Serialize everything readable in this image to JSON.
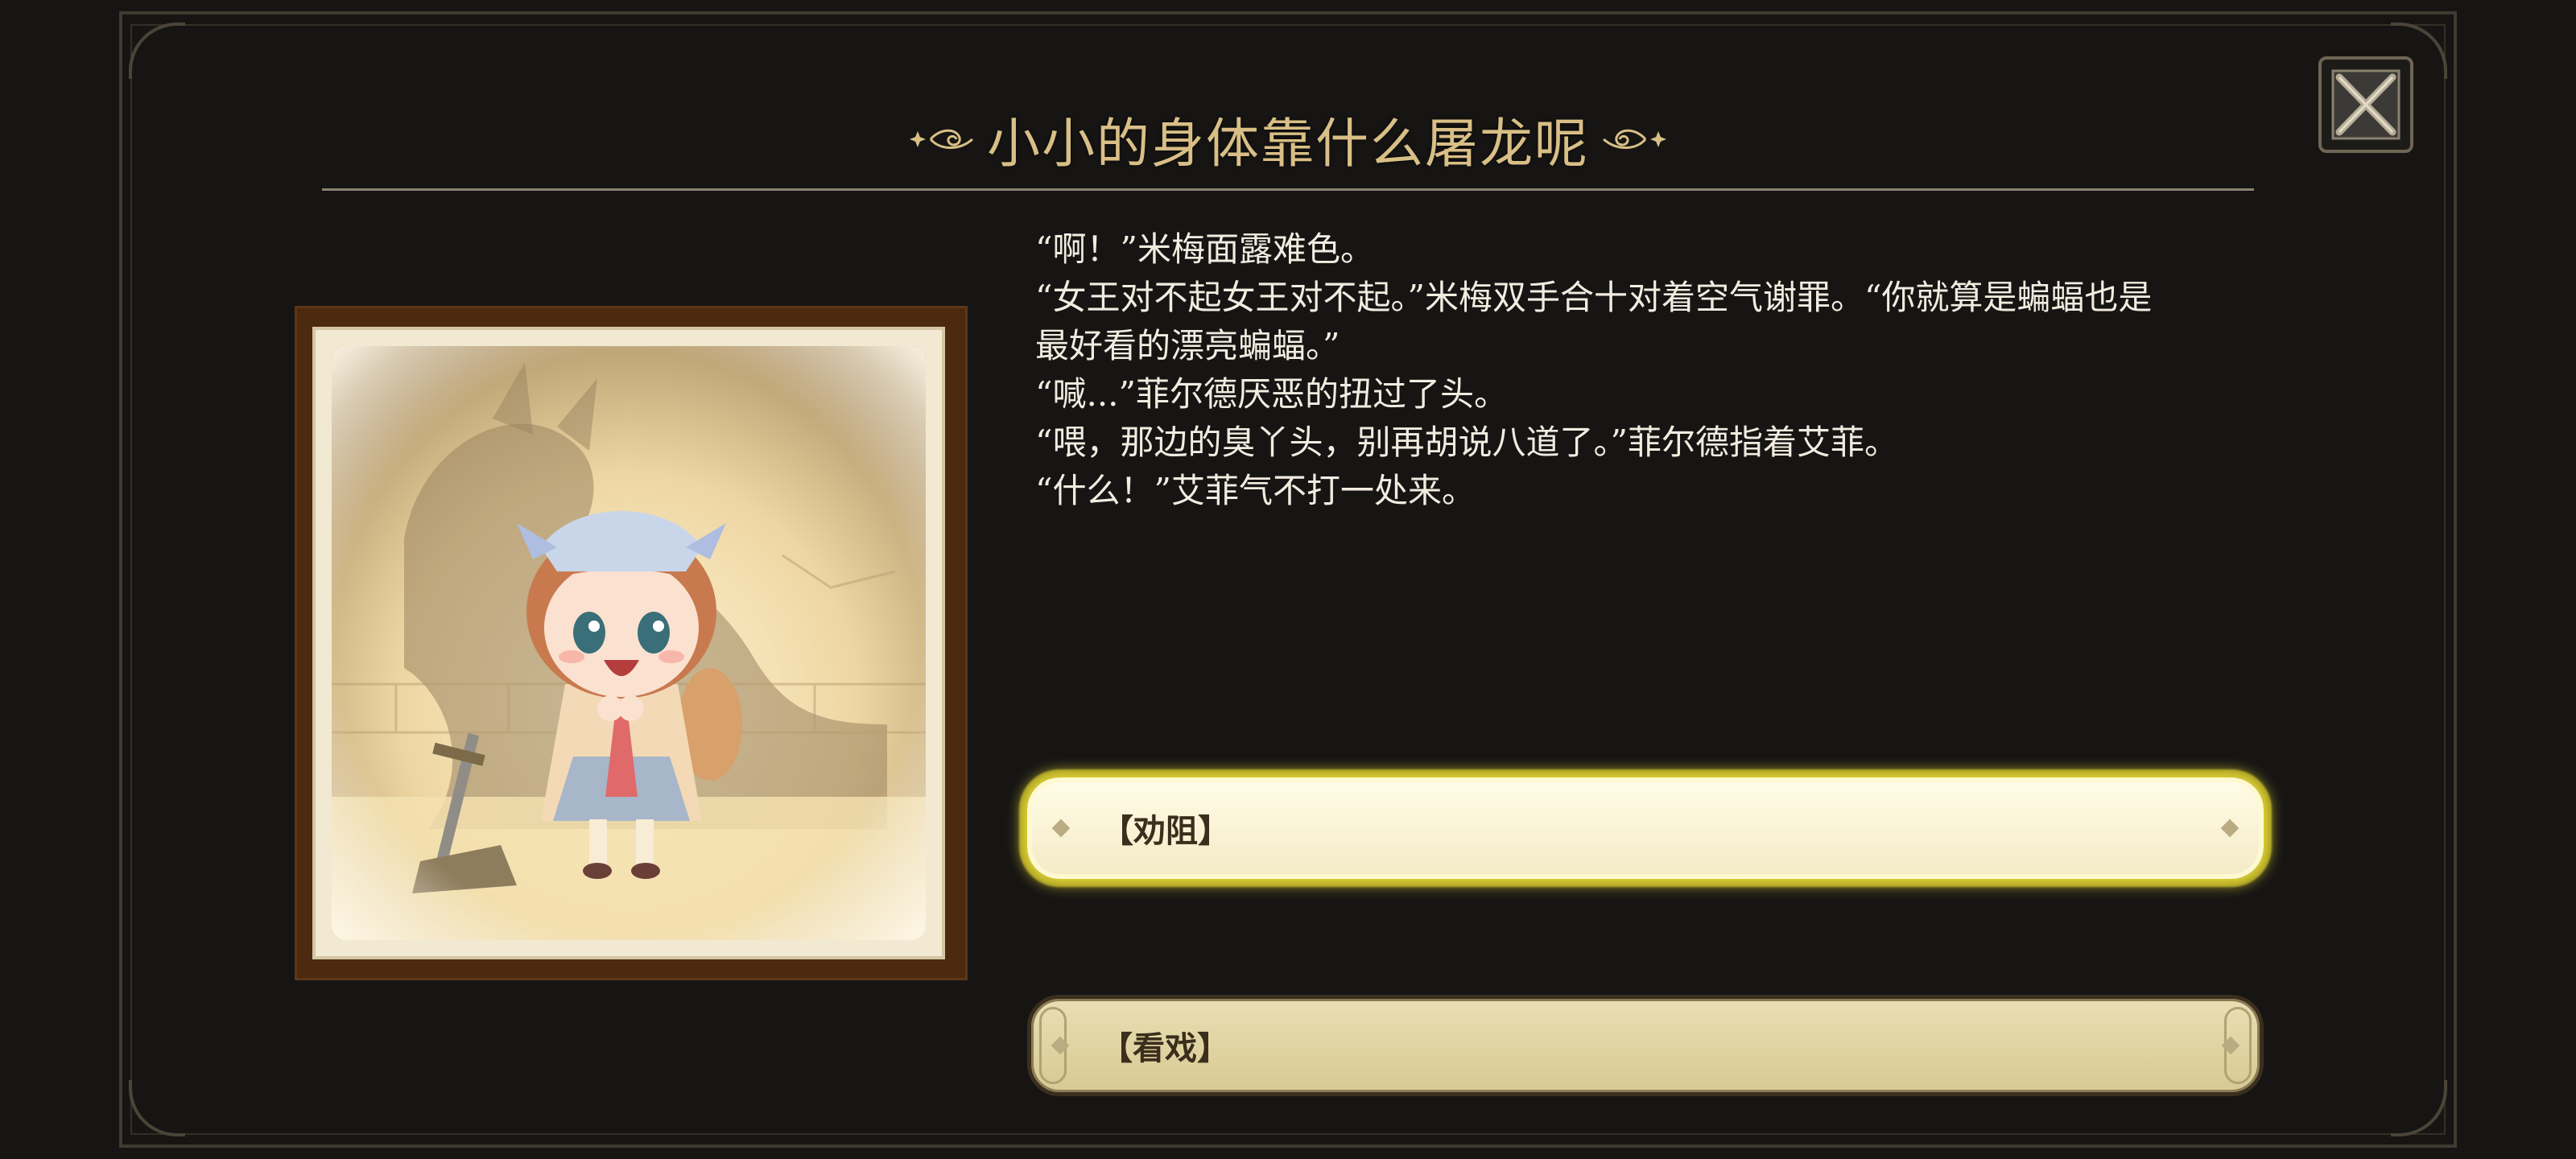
{
  "title": "小小的身体靠什么屠龙呢",
  "dialogue": [
    "“啊！”米梅面露难色。",
    "“女王对不起女王对不起。”米梅双手合十对着空气谢罪。“你就算是蝙蝠也是",
    "最好看的漂亮蝙蝠。”",
    "“喊...”菲尔德厌恶的扭过了头。",
    "“喂，那边的臭丫头，别再胡说八道了。”菲尔德指着艾菲。",
    "“什么！”艾菲气不打一处来。"
  ],
  "choices": [
    {
      "label": "【劝阻】",
      "state": "highlighted"
    },
    {
      "label": "【看戏】",
      "state": "normal"
    }
  ],
  "icons": {
    "close": "close-x-icon",
    "title_ornament": "sparkle-flourish-icon"
  },
  "colors": {
    "background": "#161514",
    "title": "#d9bf86",
    "dialogue_text": "#f2ece0",
    "choice_highlight_glow": "#ffee3c",
    "frame_wood": "#4b2a0f"
  }
}
